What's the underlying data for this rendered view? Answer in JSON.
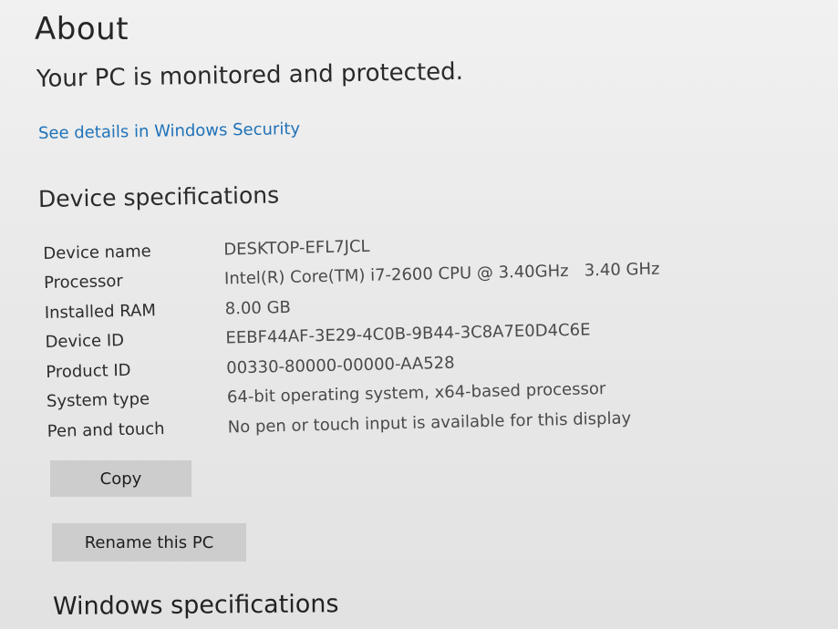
{
  "page": {
    "title": "About"
  },
  "security": {
    "status": "Your PC is monitored and protected.",
    "link_label": "See details in Windows Security"
  },
  "device_specs": {
    "heading": "Device specifications",
    "rows": [
      {
        "label": "Device name",
        "value": "DESKTOP-EFL7JCL"
      },
      {
        "label": "Processor",
        "value": "Intel(R) Core(TM) i7-2600 CPU @ 3.40GHz   3.40 GHz"
      },
      {
        "label": "Installed RAM",
        "value": "8.00 GB"
      },
      {
        "label": "Device ID",
        "value": "EEBF44AF-3E29-4C0B-9B44-3C8A7E0D4C6E"
      },
      {
        "label": "Product ID",
        "value": "00330-80000-00000-AA528"
      },
      {
        "label": "System type",
        "value": "64-bit operating system, x64-based processor"
      },
      {
        "label": "Pen and touch",
        "value": "No pen or touch input is available for this display"
      }
    ],
    "copy_label": "Copy",
    "rename_label": "Rename this PC"
  },
  "windows_specs": {
    "heading": "Windows specifications"
  },
  "colors": {
    "link": "#1f72b8",
    "button_bg": "#cdcdcd",
    "background": "#ececec"
  }
}
